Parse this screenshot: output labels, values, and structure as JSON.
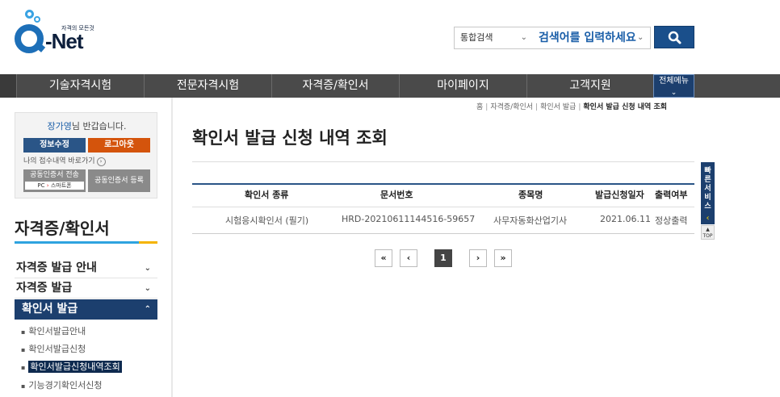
{
  "header": {
    "logo_tagline": "자격의 모든것",
    "logo_text": "-Net",
    "search": {
      "scope": "통합검색",
      "placeholder": "검색어를 입력하세요"
    }
  },
  "gnb": {
    "items": [
      "기술자격시험",
      "전문자격시험",
      "자격증/확인서",
      "마이페이지",
      "고객지원"
    ],
    "all_menu": "전체메뉴"
  },
  "login": {
    "user_name": "장가영",
    "greeting": "님 반갑습니다.",
    "edit_info": "정보수정",
    "logout": "로그아웃",
    "recv_link": "나의 접수내역 바로가기",
    "cert_send_line1": "공동인증서 전송",
    "cert_send_pc": "PC",
    "cert_send_arrow": "›",
    "cert_send_phone": "스마트폰",
    "cert_register": "공동인증서 등록"
  },
  "sidebar": {
    "title": "자격증/확인서",
    "menus": [
      "자격증 발급 안내",
      "자격증 발급",
      "확인서 발급"
    ],
    "subs": [
      "확인서발급안내",
      "확인서발급신청",
      "확인서발급신청내역조회",
      "기능경기확인서신청"
    ]
  },
  "breadcrumb": [
    "홈",
    "자격증/확인서",
    "확인서 발급",
    "확인서 발급 신청 내역 조회"
  ],
  "main": {
    "title": "확인서 발급 신청 내역 조회",
    "table": {
      "headers": [
        "확인서 종류",
        "문서번호",
        "종목명",
        "발급신청일자",
        "출력여부"
      ],
      "rows": [
        [
          "시험응시확인서 (필기)",
          "HRD-20210611144516-59657",
          "사무자동화산업기사",
          "2021.06.11",
          "정상출력"
        ]
      ]
    },
    "pagination": {
      "first": "«",
      "prev": "‹",
      "current": "1",
      "next": "›",
      "last": "»"
    }
  },
  "quick": {
    "label": "빠른서비스",
    "top": "TOP"
  }
}
